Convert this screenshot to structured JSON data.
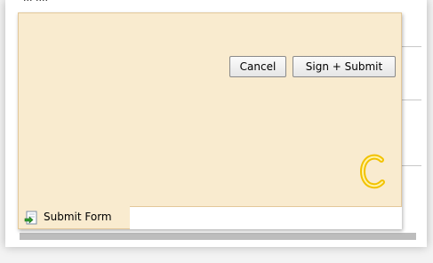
{
  "background": {
    "top_text": "··· ····"
  },
  "panel": {
    "cancel_label": "Cancel",
    "sign_submit_label": "Sign + Submit",
    "brand_mark": "C",
    "brand_color": "#f2c200"
  },
  "tab": {
    "label": "Submit Form",
    "icon": "submit-form-icon"
  },
  "colors": {
    "panel_bg": "#f9ebcf",
    "panel_border": "#e3c89a"
  }
}
